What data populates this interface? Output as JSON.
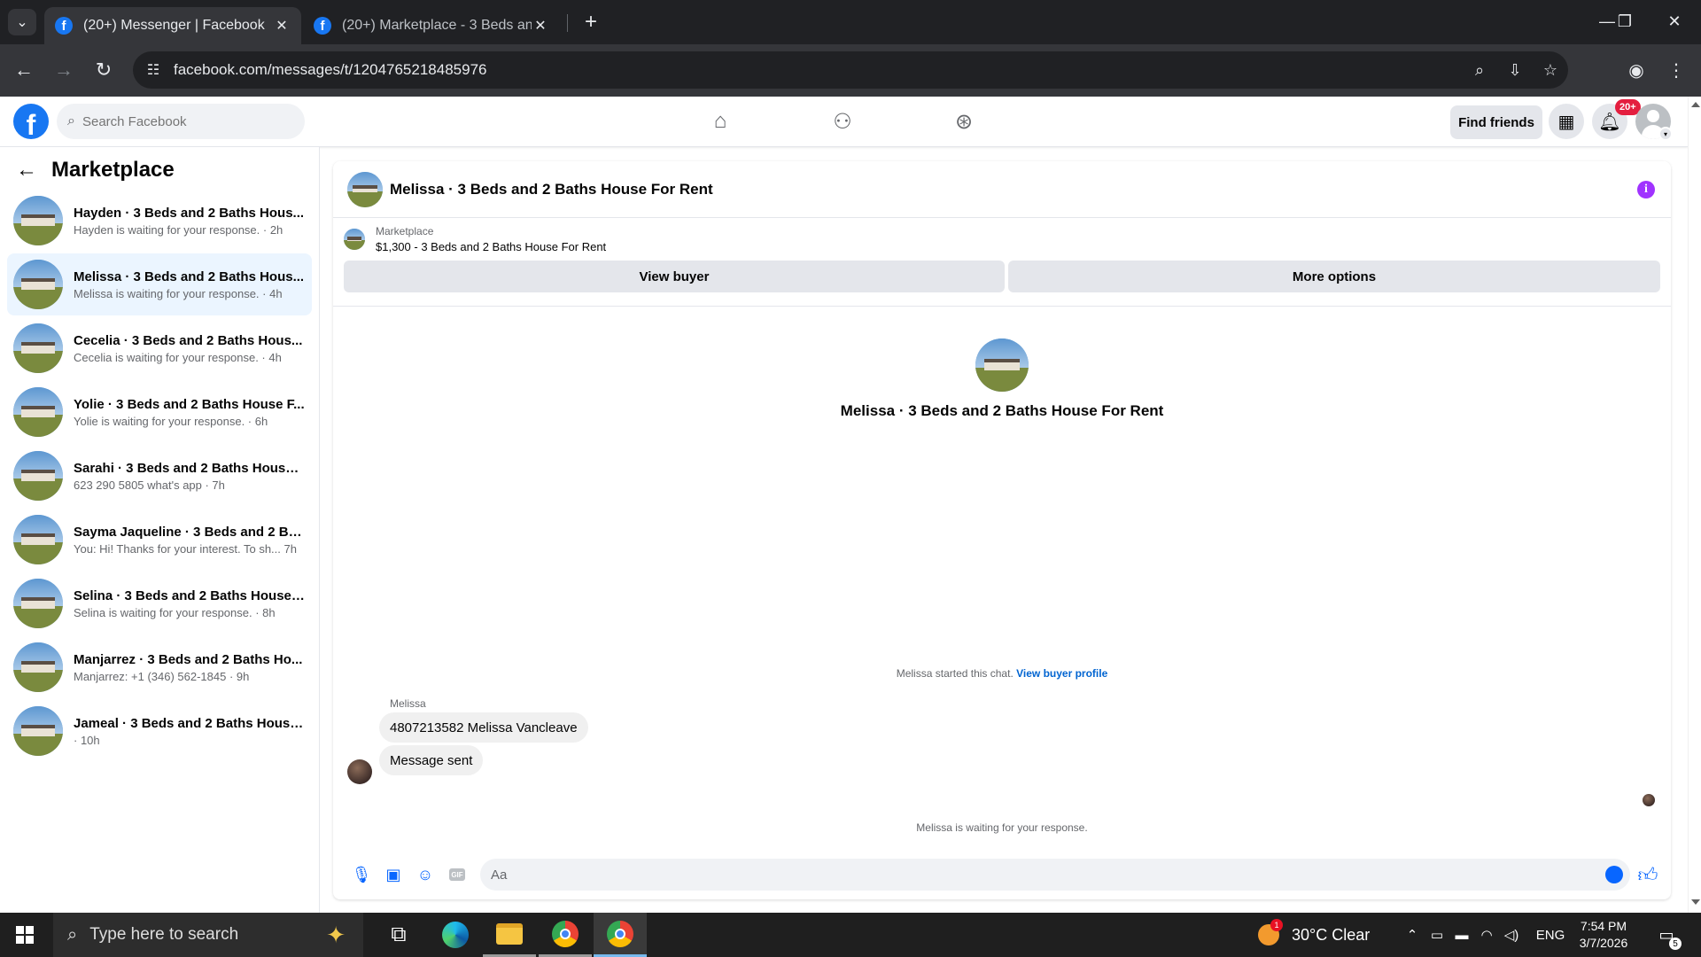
{
  "browser": {
    "tabs": [
      {
        "title": "(20+) Messenger | Facebook",
        "active": true
      },
      {
        "title": "(20+) Marketplace - 3 Beds and",
        "active": false
      }
    ],
    "new_tab": "+",
    "url": "facebook.com/messages/t/1204765218485976",
    "window_controls": {
      "minimize": "—",
      "maximize": "❐",
      "close": "✕"
    }
  },
  "fb_header": {
    "logo": "f",
    "search_placeholder": "Search Facebook",
    "nav_icons": [
      "home-icon",
      "friends-icon",
      "groups-icon"
    ],
    "find_friends": "Find friends",
    "notification_badge": "20+"
  },
  "sidebar": {
    "title": "Marketplace",
    "conversations": [
      {
        "name": "Hayden · 3 Beds and 2 Baths Hous...",
        "preview": "Hayden is waiting for your response. · 2h"
      },
      {
        "name": "Melissa · 3 Beds and 2 Baths Hous...",
        "preview": "Melissa is waiting for your response. · 4h"
      },
      {
        "name": "Cecelia · 3 Beds and 2 Baths Hous...",
        "preview": "Cecelia is waiting for your response. · 4h"
      },
      {
        "name": "Yolie · 3 Beds and 2 Baths House F...",
        "preview": "Yolie is waiting for your response. · 6h"
      },
      {
        "name": "Sarahi · 3 Beds and 2 Baths House ...",
        "preview": "623 290 5805 what's app · 7h"
      },
      {
        "name": "Sayma Jaqueline · 3 Beds and 2 Ba...",
        "preview": "You: Hi! Thanks for your interest. To sh... 7h"
      },
      {
        "name": "Selina · 3 Beds and 2 Baths House ...",
        "preview": "Selina is waiting for your response. · 8h"
      },
      {
        "name": "Manjarrez · 3 Beds and 2 Baths Ho...",
        "preview": "Manjarrez: +1 (346) 562-1845 · 9h"
      },
      {
        "name": "Jameal · 3 Beds and 2 Baths House...",
        "preview": "· 10h"
      }
    ],
    "selected_index": 1
  },
  "chat": {
    "title": "Melissa · 3 Beds and 2 Baths House For Rent",
    "marketplace_label": "Marketplace",
    "listing": "$1,300 - 3 Beds and 2 Baths House For Rent",
    "view_buyer": "View buyer",
    "more_options": "More options",
    "profile_name": "Melissa · 3 Beds and 2 Baths House For Rent",
    "started_text": "Melissa started this chat.",
    "view_buyer_profile": "View buyer profile",
    "sender": "Melissa",
    "messages": [
      "4807213582 Melissa Vancleave",
      "Message sent"
    ],
    "waiting_text": "Melissa is waiting for your response.",
    "composer_placeholder": "Aa",
    "gif_label": "GIF"
  },
  "taskbar": {
    "search_placeholder": "Type here to search",
    "weather": "30°C  Clear",
    "weather_badge": "1",
    "language": "ENG",
    "time": "7:54 PM",
    "date": "3/7/2026",
    "notification_count": "5"
  },
  "colors": {
    "facebook_blue": "#1877f2",
    "selected_conversation": "#ebf5ff",
    "info_purple": "#a033ff",
    "badge_red": "#e41e3f"
  }
}
